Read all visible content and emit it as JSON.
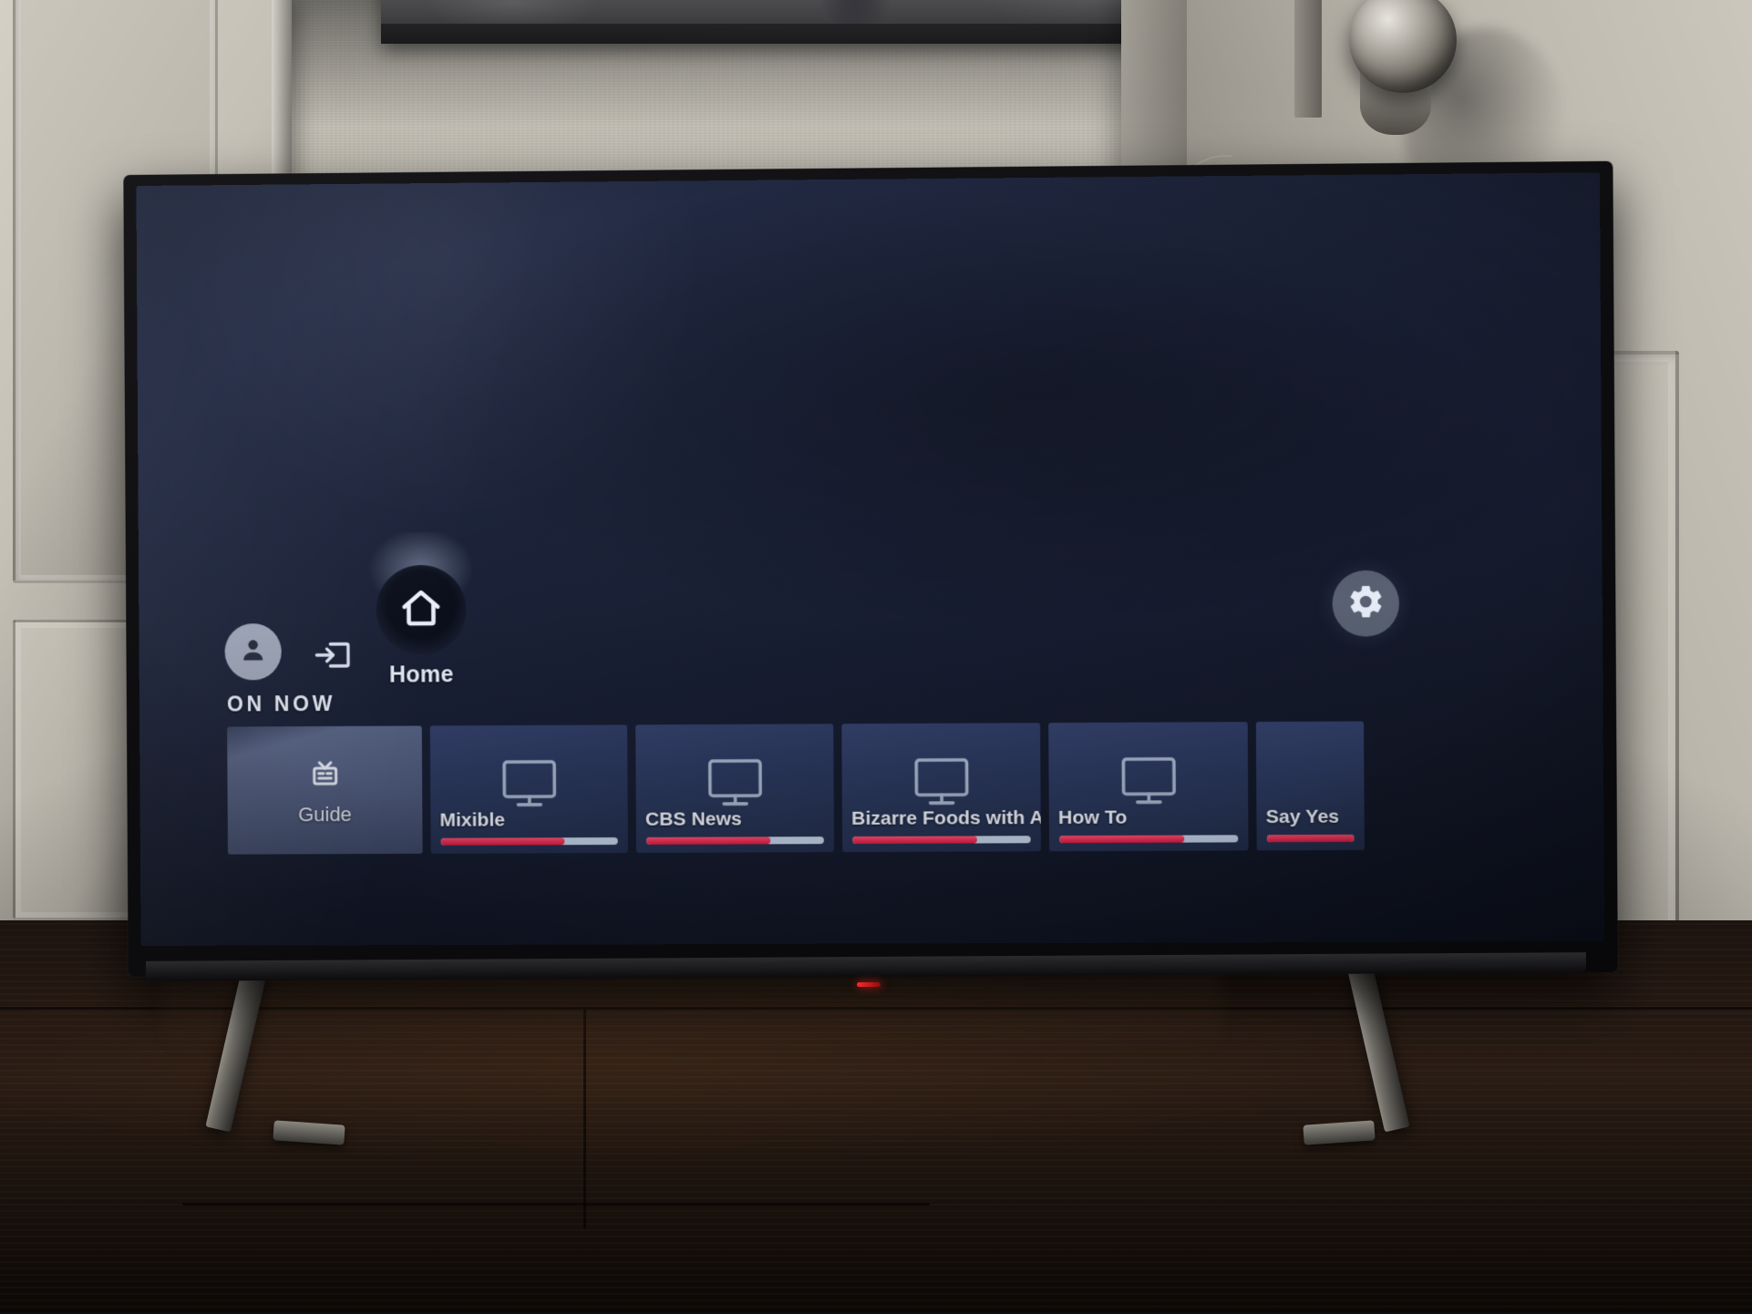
{
  "scene": {
    "description": "Photo of a smart TV home screen in a dark room",
    "background": {
      "left_door": "white-paneled-door",
      "right_door": "white-paneled-door-with-knob",
      "artwork": "dark-canvas-painting",
      "surface": "dark-wood-console"
    }
  },
  "tv_ui": {
    "nav": {
      "profile": {
        "icon": "person-icon",
        "label": ""
      },
      "source": {
        "icon": "input-source-icon",
        "label": ""
      },
      "home": {
        "icon": "home-icon",
        "label": "Home",
        "selected": true
      }
    },
    "settings": {
      "icon": "gear-icon",
      "label": ""
    },
    "section": {
      "title": "ON NOW"
    },
    "guide_tile": {
      "icon": "tv-antenna-icon",
      "label": "Guide",
      "selected": true
    },
    "channels": [
      {
        "name": "Mixible",
        "icon": "monitor-icon",
        "progress": 70
      },
      {
        "name": "CBS News",
        "icon": "monitor-icon",
        "progress": 70
      },
      {
        "name": "Bizarre Foods with Andrew …",
        "icon": "monitor-icon",
        "progress": 70
      },
      {
        "name": "How To",
        "icon": "monitor-icon",
        "progress": 70
      },
      {
        "name": "Say Yes",
        "icon": "monitor-icon",
        "progress": 100
      }
    ],
    "colors": {
      "screen_bg": "#1c2339",
      "tile_bg": "#2d3a61",
      "tile_selected_bg": "#5a6687",
      "progress_fill": "#e8173f",
      "progress_track": "#c6d6ea",
      "text": "#f2f5fc"
    }
  }
}
